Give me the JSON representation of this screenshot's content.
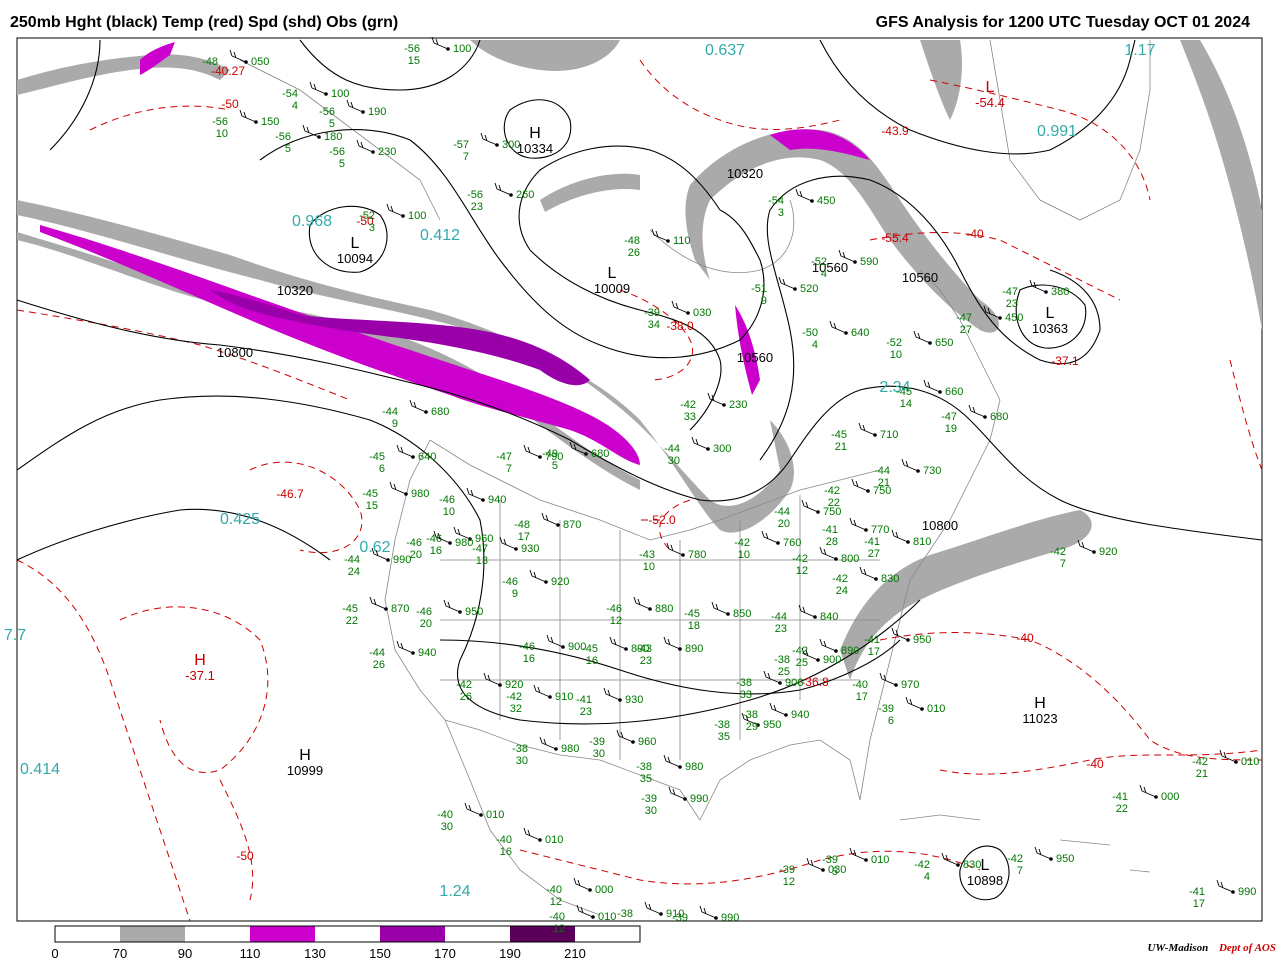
{
  "header": {
    "left_title": "250mb Hght (black) Temp (red) Spd (shd) Obs (grn)",
    "right_title": "GFS Analysis for 1200 UTC Tuesday OCT 01 2024"
  },
  "colors": {
    "height_contour": "#000000",
    "temperature_contour": "#cc0000",
    "observations": "#007700",
    "pressure_labels": "#33aaaa",
    "speed_70_90": "#aaaaaa",
    "speed_110_130": "#cc00cc",
    "speed_150_170": "#9900aa",
    "speed_190_210": "#5a005a",
    "borders": "#888888"
  },
  "legend": {
    "ticks": [
      "0",
      "70",
      "90",
      "110",
      "130",
      "150",
      "170",
      "190",
      "210"
    ]
  },
  "centers": [
    {
      "type": "H",
      "value": "10999"
    },
    {
      "type": "H",
      "value": "-37.1"
    },
    {
      "type": "L",
      "value": "10094"
    },
    {
      "type": "L",
      "value": "10009"
    },
    {
      "type": "H",
      "value": "10334"
    },
    {
      "type": "L",
      "value": "10363"
    },
    {
      "type": "L",
      "value": "10898"
    },
    {
      "type": "H",
      "value": "11023"
    },
    {
      "type": "L",
      "value": "-54.4"
    }
  ],
  "height_labels": [
    "10800",
    "10800",
    "10320",
    "10320",
    "10560",
    "10560",
    "10560"
  ],
  "temp_labels": [
    "-46.7",
    "-38.0",
    "-52.0",
    "-36.8",
    "-40",
    "-40",
    "-55.4",
    "-43.9",
    "-37.1",
    "-40",
    "-50",
    "-50",
    "-40.27",
    "-50"
  ],
  "cyan_labels": [
    "0.425",
    "0.414",
    "0.968",
    "0.412",
    "1.24",
    "2.34",
    "0.991",
    "1.17",
    "0.637",
    "0.62",
    "7.7"
  ],
  "observations": [
    {
      "t": "-45",
      "h": "870",
      "d": "22"
    },
    {
      "t": "-44",
      "h": "940",
      "d": "26"
    },
    {
      "t": "-46",
      "h": "950",
      "d": "20"
    },
    {
      "t": "-42",
      "h": "920",
      "d": "26"
    },
    {
      "t": "-42",
      "h": "910",
      "d": "32"
    },
    {
      "t": "-41",
      "h": "930",
      "d": "23"
    },
    {
      "t": "-46",
      "h": "900",
      "d": "16"
    },
    {
      "t": "-45",
      "h": "890",
      "d": "16"
    },
    {
      "t": "-43",
      "h": "890",
      "d": "23"
    },
    {
      "t": "-46",
      "h": "880",
      "d": "12"
    },
    {
      "t": "-45",
      "h": "850",
      "d": "18"
    },
    {
      "t": "-44",
      "h": "840",
      "d": "23"
    },
    {
      "t": "-46",
      "h": "920",
      "d": "9"
    },
    {
      "t": "-48",
      "h": "870",
      "d": "17"
    },
    {
      "t": "-47",
      "h": "930",
      "d": "13"
    },
    {
      "t": "-46",
      "h": "960",
      "d": "16"
    },
    {
      "t": "-46",
      "h": "980",
      "d": "20"
    },
    {
      "t": "-44",
      "h": "990",
      "d": "24"
    },
    {
      "t": "-45",
      "h": "980",
      "d": "15"
    },
    {
      "t": "-46",
      "h": "940",
      "d": "10"
    },
    {
      "t": "-47",
      "h": "790",
      "d": "7"
    },
    {
      "t": "-49",
      "h": "680",
      "d": "5"
    },
    {
      "t": "-45",
      "h": "640",
      "d": "6"
    },
    {
      "t": "-44",
      "h": "680",
      "d": "9"
    },
    {
      "t": "-38",
      "h": "980",
      "d": "30"
    },
    {
      "t": "-39",
      "h": "960",
      "d": "30"
    },
    {
      "t": "-38",
      "h": "980",
      "d": "35"
    },
    {
      "t": "-39",
      "h": "990",
      "d": "30"
    },
    {
      "t": "-38",
      "h": "950",
      "d": "35"
    },
    {
      "t": "-38",
      "h": "940",
      "d": "29"
    },
    {
      "t": "-38",
      "h": "906",
      "d": "33"
    },
    {
      "t": "-42",
      "h": "890",
      "d": "25"
    },
    {
      "t": "-38",
      "h": "900",
      "d": "25"
    },
    {
      "t": "-40",
      "h": "970",
      "d": "17"
    },
    {
      "t": "-41",
      "h": "950",
      "d": "17"
    },
    {
      "t": "-39",
      "h": "010",
      "d": "6"
    },
    {
      "t": "-40",
      "h": "010",
      "d": "30"
    },
    {
      "t": "-40",
      "h": "010",
      "d": "16"
    },
    {
      "t": "-40",
      "h": "000",
      "d": "12"
    },
    {
      "t": "-39",
      "h": "030",
      "d": "12"
    },
    {
      "t": "-39",
      "h": "010",
      "d": "5"
    },
    {
      "t": "-42",
      "h": "830",
      "d": "4"
    },
    {
      "t": "-42",
      "h": "950",
      "d": "7"
    },
    {
      "t": "-41",
      "h": "990",
      "d": "17"
    },
    {
      "t": "-41",
      "h": "000",
      "d": "22"
    },
    {
      "t": "-42",
      "h": "010",
      "d": "21"
    },
    {
      "t": "-42",
      "h": "920",
      "d": "7"
    },
    {
      "t": "-38",
      "h": "910",
      "d": ""
    },
    {
      "t": "-39",
      "h": "990",
      "d": ""
    },
    {
      "t": "-40",
      "h": "010",
      "d": "12"
    },
    {
      "t": "-44",
      "h": "730",
      "d": "21"
    },
    {
      "t": "-44",
      "h": "750",
      "d": "20"
    },
    {
      "t": "-42",
      "h": "750",
      "d": "22"
    },
    {
      "t": "-45",
      "h": "710",
      "d": "21"
    },
    {
      "t": "-47",
      "h": "680",
      "d": "19"
    },
    {
      "t": "-45",
      "h": "660",
      "d": "14"
    },
    {
      "t": "-52",
      "h": "650",
      "d": "10"
    },
    {
      "t": "-50",
      "h": "640",
      "d": "4"
    },
    {
      "t": "-51",
      "h": "520",
      "d": "9"
    },
    {
      "t": "-54",
      "h": "450",
      "d": "3"
    },
    {
      "t": "-52",
      "h": "590",
      "d": "4"
    },
    {
      "t": "-47",
      "h": "380",
      "d": "23"
    },
    {
      "t": "-47",
      "h": "450",
      "d": "27"
    },
    {
      "t": "-42",
      "h": "230",
      "d": "33"
    },
    {
      "t": "-44",
      "h": "300",
      "d": "30"
    },
    {
      "t": "-42",
      "h": "760",
      "d": "10"
    },
    {
      "t": "-43",
      "h": "780",
      "d": "10"
    },
    {
      "t": "-42",
      "h": "800",
      "d": "12"
    },
    {
      "t": "-41",
      "h": "770",
      "d": "28"
    },
    {
      "t": "-42",
      "h": "830",
      "d": "24"
    },
    {
      "t": "-41",
      "h": "810",
      "d": "27"
    },
    {
      "t": "-48",
      "h": "110",
      "d": "26"
    },
    {
      "t": "-39",
      "h": "030",
      "d": "34"
    },
    {
      "t": "-56",
      "h": "260",
      "d": "23"
    },
    {
      "t": "-57",
      "h": "300",
      "d": "7"
    },
    {
      "t": "-56",
      "h": "230",
      "d": "5"
    },
    {
      "t": "-56",
      "h": "180",
      "d": "5"
    },
    {
      "t": "-56",
      "h": "190",
      "d": "5"
    },
    {
      "t": "-56",
      "h": "150",
      "d": "10"
    },
    {
      "t": "-54",
      "h": "100",
      "d": "4"
    },
    {
      "t": "-48",
      "h": "050",
      "d": ""
    },
    {
      "t": "-56",
      "h": "100",
      "d": "15"
    },
    {
      "t": "-52",
      "h": "100",
      "d": "3"
    }
  ],
  "credit": {
    "org": "UW-Madison",
    "dept": "Dept of AOS"
  }
}
